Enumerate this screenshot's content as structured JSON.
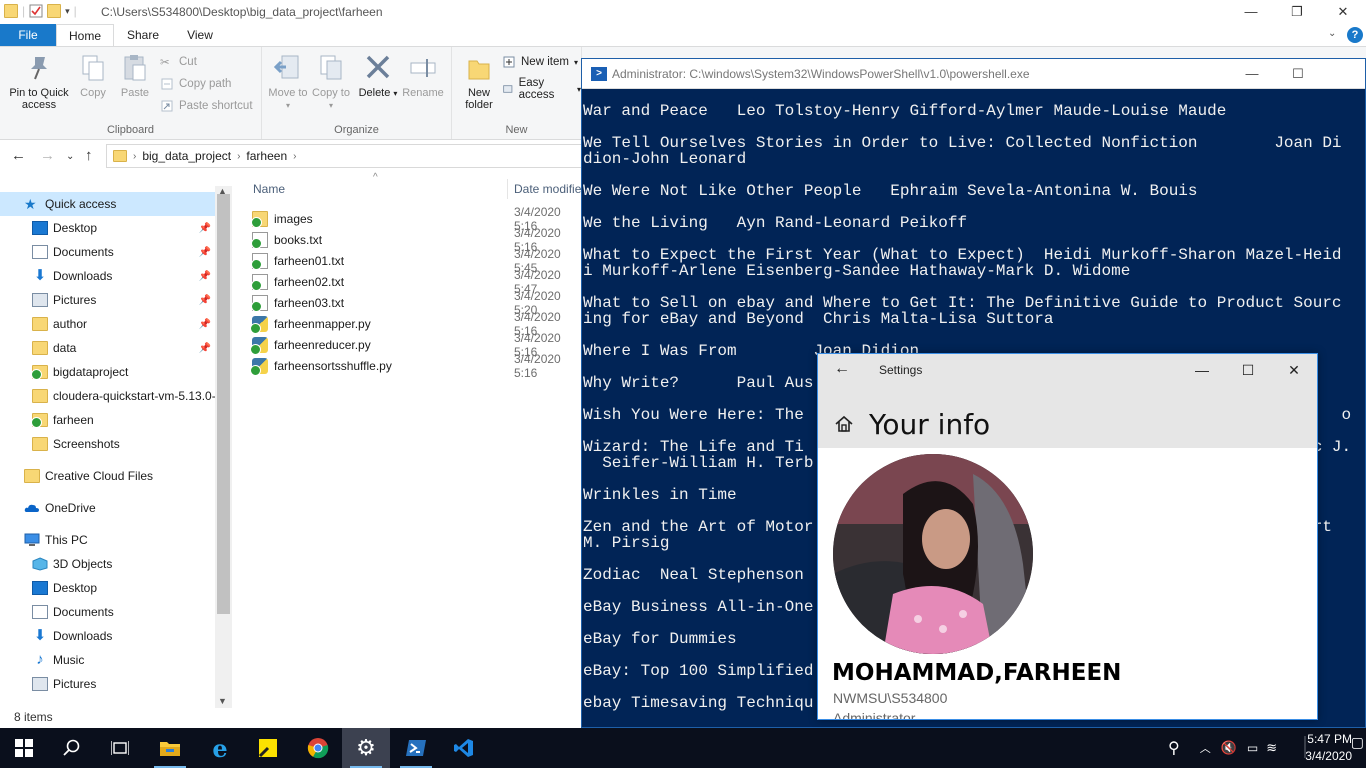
{
  "explorer": {
    "title_path": "C:\\Users\\S534800\\Desktop\\big_data_project\\farheen",
    "tabs": [
      "File",
      "Home",
      "Share",
      "View"
    ],
    "ribbon": {
      "clipboard": {
        "pin_label": "Pin to Quick access",
        "copy_label": "Copy",
        "paste_label": "Paste",
        "cut_label": "Cut",
        "copy_path_label": "Copy path",
        "paste_shortcut_label": "Paste shortcut",
        "group_label": "Clipboard"
      },
      "organize": {
        "move_to_label": "Move to",
        "copy_to_label": "Copy to",
        "delete_label": "Delete",
        "rename_label": "Rename",
        "group_label": "Organize"
      },
      "new": {
        "new_folder_label": "New folder",
        "new_item_label": "New item",
        "easy_access_label": "Easy access",
        "group_label": "New"
      }
    },
    "breadcrumb": [
      "big_data_project",
      "farheen"
    ],
    "nav": {
      "quick_access": "Quick access",
      "pinned": [
        {
          "label": "Desktop",
          "icon": "desktop-icon"
        },
        {
          "label": "Documents",
          "icon": "documents-icon"
        },
        {
          "label": "Downloads",
          "icon": "downloads-icon"
        },
        {
          "label": "Pictures",
          "icon": "pictures-icon"
        },
        {
          "label": "author",
          "icon": "folder-icon"
        },
        {
          "label": "data",
          "icon": "folder-icon"
        }
      ],
      "recent": [
        {
          "label": "bigdataproject",
          "icon": "synced-folder-icon"
        },
        {
          "label": "cloudera-quickstart-vm-5.13.0-",
          "icon": "folder-icon"
        },
        {
          "label": "farheen",
          "icon": "synced-folder-icon"
        },
        {
          "label": "Screenshots",
          "icon": "folder-icon"
        }
      ],
      "creative_cloud": "Creative Cloud Files",
      "onedrive": "OneDrive",
      "this_pc": "This PC",
      "pc_items": [
        {
          "label": "3D Objects",
          "icon": "3d-objects-icon"
        },
        {
          "label": "Desktop",
          "icon": "desktop-icon"
        },
        {
          "label": "Documents",
          "icon": "documents-icon"
        },
        {
          "label": "Downloads",
          "icon": "downloads-icon"
        },
        {
          "label": "Music",
          "icon": "music-icon"
        },
        {
          "label": "Pictures",
          "icon": "pictures-icon"
        }
      ]
    },
    "columns": {
      "name": "Name",
      "date": "Date modifie"
    },
    "files": [
      {
        "name": "images",
        "date": "3/4/2020 5:16",
        "type": "folder"
      },
      {
        "name": "books.txt",
        "date": "3/4/2020 5:16",
        "type": "txt"
      },
      {
        "name": "farheen01.txt",
        "date": "3/4/2020 5:45",
        "type": "txt"
      },
      {
        "name": "farheen02.txt",
        "date": "3/4/2020 5:47",
        "type": "txt"
      },
      {
        "name": "farheen03.txt",
        "date": "3/4/2020 5:20",
        "type": "txt"
      },
      {
        "name": "farheenmapper.py",
        "date": "3/4/2020 5:16",
        "type": "py"
      },
      {
        "name": "farheenreducer.py",
        "date": "3/4/2020 5:16",
        "type": "py"
      },
      {
        "name": "farheensortsshuffle.py",
        "date": "3/4/2020 5:16",
        "type": "py"
      }
    ],
    "status": "8 items"
  },
  "powershell": {
    "title": "Administrator: C:\\windows\\System32\\WindowsPowerShell\\v1.0\\powershell.exe",
    "lines": [
      "War and Peace   Leo Tolstoy-Henry Gifford-Aylmer Maude-Louise Maude",
      "",
      "We Tell Ourselves Stories in Order to Live: Collected Nonfiction        Joan Di",
      "dion-John Leonard",
      "",
      "We Were Not Like Other People   Ephraim Sevela-Antonina W. Bouis",
      "",
      "We the Living   Ayn Rand-Leonard Peikoff",
      "",
      "What to Expect the First Year (What to Expect)  Heidi Murkoff-Sharon Mazel-Heid",
      "i Murkoff-Arlene Eisenberg-Sandee Hathaway-Mark D. Widome",
      "",
      "What to Sell on ebay and Where to Get It: The Definitive Guide to Product Sourc",
      "ing for eBay and Beyond  Chris Malta-Lisa Suttora",
      "",
      "Where I Was From        Joan Didion",
      "",
      "Why Write?      Paul Aus",
      "",
      "Wish You Were Here: The                                                        o",
      "",
      "Wizard: The Life and Ti                                                   arc J.",
      "  Seifer-William H. Terb",
      "",
      "Wrinkles in Time",
      "",
      "Zen and the Art of Motor                                                 obert",
      "M. Pirsig",
      "",
      "Zodiac  Neal Stephenson",
      "",
      "eBay Business All-in-One",
      "",
      "eBay for Dummies",
      "",
      "eBay: Top 100 Simplified",
      "",
      "ebay Timesaving Techniqu"
    ]
  },
  "settings": {
    "window_title": "Settings",
    "heading": "Your info",
    "name": "MOHAMMAD,FARHEEN",
    "account": "NWMSU\\S534800",
    "role": "Administrator"
  },
  "taskbar": {
    "time": "5:47 PM",
    "date": "3/4/2020"
  },
  "colors": {
    "powershell_bg": "#012456",
    "accent": "#1979ca",
    "taskbar_bg": "#0a0f1c"
  }
}
